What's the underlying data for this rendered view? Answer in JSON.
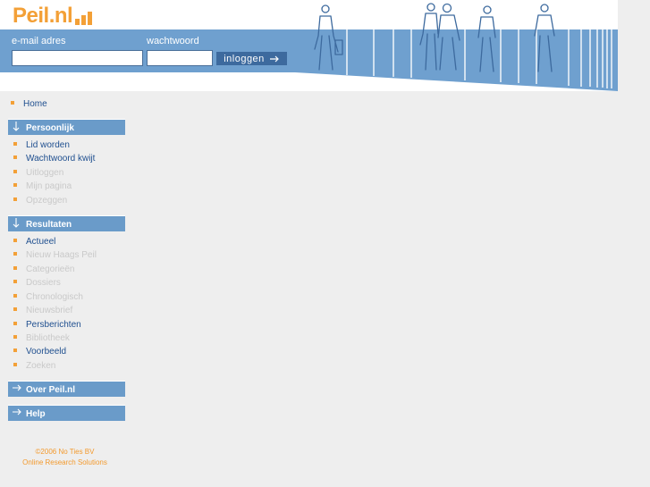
{
  "header": {
    "logo_text": "Peil.nl",
    "email_label": "e-mail adres",
    "email_value": "",
    "password_label": "wachtwoord",
    "password_value": "",
    "login_label": "inloggen"
  },
  "sidebar": {
    "home": {
      "label": "Home",
      "active": true
    },
    "sections": [
      {
        "title": "Persoonlijk",
        "icon": "arrow-down-icon",
        "items": [
          {
            "label": "Lid worden",
            "active": true
          },
          {
            "label": "Wachtwoord kwijt",
            "active": true
          },
          {
            "label": "Uitloggen",
            "active": false
          },
          {
            "label": "Mijn pagina",
            "active": false
          },
          {
            "label": "Opzeggen",
            "active": false
          }
        ]
      },
      {
        "title": "Resultaten",
        "icon": "arrow-down-icon",
        "items": [
          {
            "label": "Actueel",
            "active": true
          },
          {
            "label": "Nieuw Haags Peil",
            "active": false
          },
          {
            "label": "Categorieën",
            "active": false
          },
          {
            "label": "Dossiers",
            "active": false
          },
          {
            "label": "Chronologisch",
            "active": false
          },
          {
            "label": "Nieuwsbrief",
            "active": false
          },
          {
            "label": "Persberichten",
            "active": true
          },
          {
            "label": "Bibliotheek",
            "active": false
          },
          {
            "label": "Voorbeeld",
            "active": true
          },
          {
            "label": "Zoeken",
            "active": false
          }
        ]
      },
      {
        "title": "Over Peil.nl",
        "icon": "arrow-right-icon",
        "items": []
      },
      {
        "title": "Help",
        "icon": "arrow-right-icon",
        "items": []
      }
    ]
  },
  "footer": {
    "line1": "©2006 No Ties BV",
    "line2": "Online Research Solutions"
  },
  "colors": {
    "brand_orange": "#f3a037",
    "header_blue": "#6fa0cf",
    "section_blue": "#6a9bc9",
    "link_blue": "#1f4f8f",
    "inactive_gray": "#c9c9c9",
    "page_bg": "#eeeeee"
  }
}
